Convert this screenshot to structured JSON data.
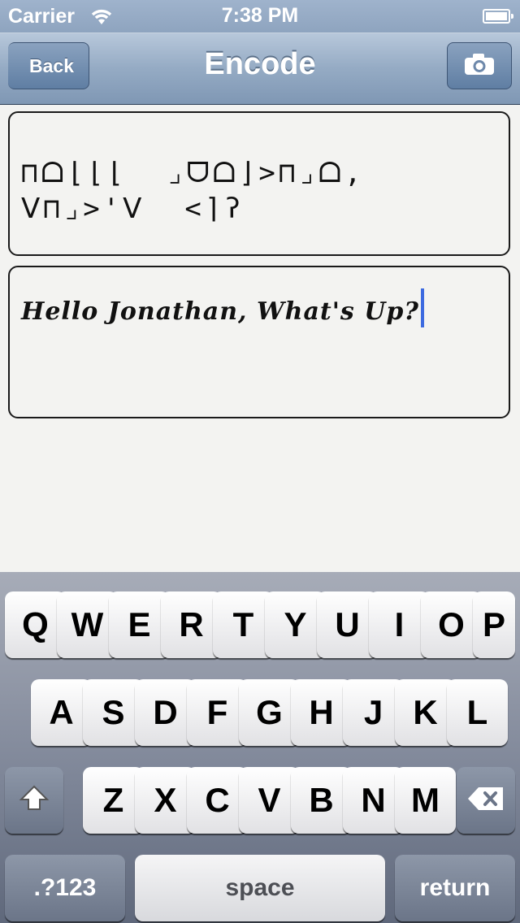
{
  "status_bar": {
    "carrier": "Carrier",
    "time": "7:38 PM",
    "wifi_icon": "wifi-icon",
    "battery_icon": "battery-icon"
  },
  "nav": {
    "title": "Encode",
    "back_label": "Back",
    "camera_icon": "camera-icon"
  },
  "encoded": {
    "text": "⊓ᗝ⌊⌊⌊  ⌟ᗜᗝ⌋>⊓⌟ᗝ,\nᐯ⊓⌟>'ᐯ  <⌉ʔ"
  },
  "plain": {
    "text": "Hello Jonathan, What's Up?"
  },
  "keyboard": {
    "row1": [
      "Q",
      "W",
      "E",
      "R",
      "T",
      "Y",
      "U",
      "I",
      "O",
      "P"
    ],
    "row2": [
      "A",
      "S",
      "D",
      "F",
      "G",
      "H",
      "J",
      "K",
      "L"
    ],
    "row3": [
      "Z",
      "X",
      "C",
      "V",
      "B",
      "N",
      "M"
    ],
    "shift_icon": "shift-icon",
    "delete_icon": "delete-icon",
    "numbers_label": ".?123",
    "space_label": "space",
    "return_label": "return"
  },
  "colors": {
    "nav_accent": "#8ea4bf",
    "caret": "#3c6ae0"
  }
}
